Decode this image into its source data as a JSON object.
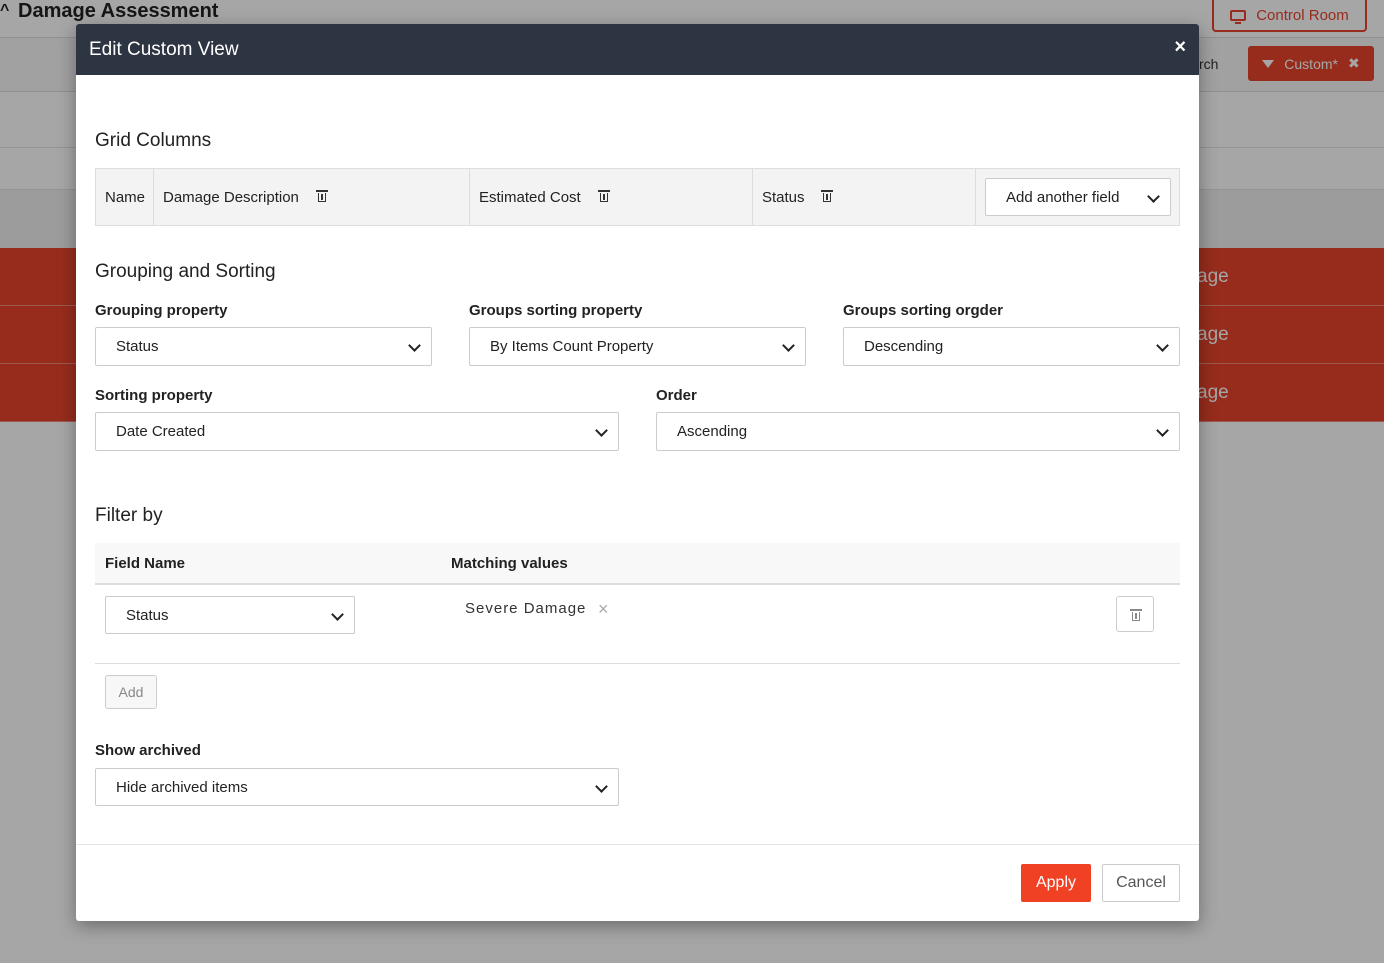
{
  "background": {
    "page_title": "Damage Assessment",
    "control_room_label": "Control Room",
    "search_fragment": "rch",
    "custom_view_label": "Custom*",
    "row_label_fragments": [
      "age",
      "age",
      "age"
    ]
  },
  "modal": {
    "title": "Edit Custom View",
    "close_symbol": "×",
    "grid_columns": {
      "title": "Grid Columns",
      "columns": [
        "Name",
        "Damage Description",
        "Estimated Cost",
        "Status"
      ],
      "add_field_placeholder": "Add another field"
    },
    "grouping": {
      "title": "Grouping and Sorting",
      "grouping_property": {
        "label": "Grouping property",
        "value": "Status"
      },
      "groups_sorting_property": {
        "label": "Groups sorting property",
        "value": "By Items Count Property"
      },
      "groups_sorting_order": {
        "label": "Groups sorting orgder",
        "value": "Descending"
      },
      "sorting_property": {
        "label": "Sorting property",
        "value": "Date Created"
      },
      "order": {
        "label": "Order",
        "value": "Ascending"
      }
    },
    "filter": {
      "title": "Filter by",
      "field_name_header": "Field Name",
      "matching_values_header": "Matching values",
      "rows": [
        {
          "field": "Status",
          "values": [
            "Severe Damage"
          ]
        }
      ],
      "remove_symbol": "×",
      "add_label": "Add"
    },
    "archived": {
      "label": "Show archived",
      "value": "Hide archived items"
    },
    "footer": {
      "apply_label": "Apply",
      "cancel_label": "Cancel"
    }
  },
  "colors": {
    "accent": "#e8442c",
    "header_dark": "#2d3442",
    "apply": "#f04124"
  },
  "icons": [
    "close-icon",
    "trash-icon",
    "chevron-down-icon",
    "monitor-icon",
    "filter-icon"
  ]
}
